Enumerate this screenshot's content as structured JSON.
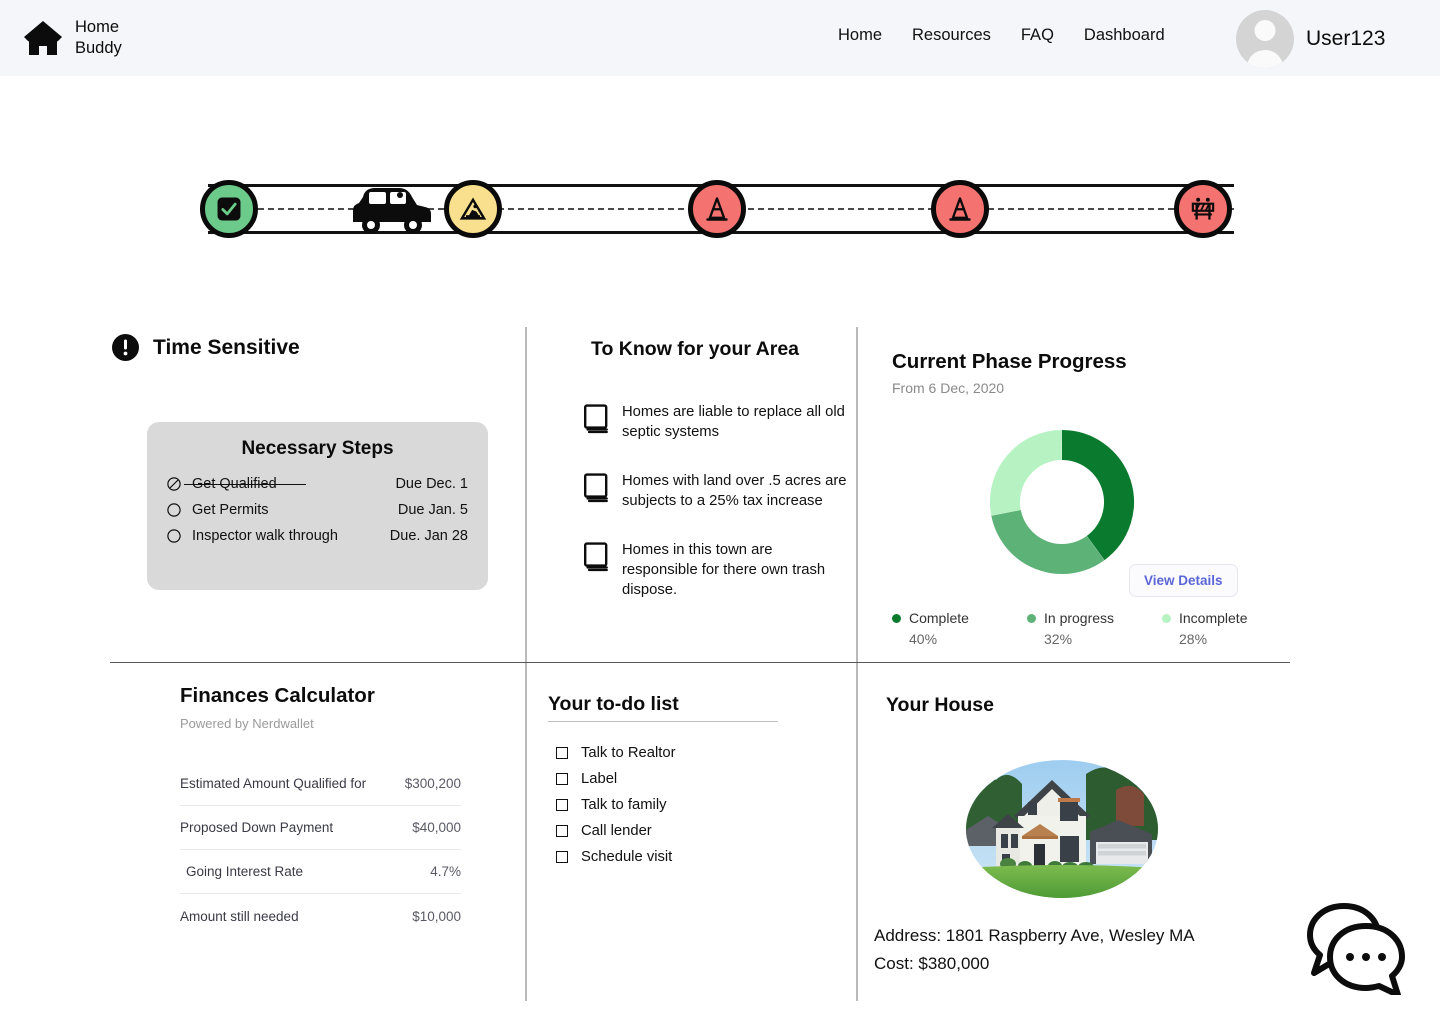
{
  "brand": {
    "line1": "Home",
    "line2": "Buddy",
    "icon": "house-icon"
  },
  "nav": {
    "items": [
      {
        "label": "Home"
      },
      {
        "label": "Resources"
      },
      {
        "label": "FAQ"
      },
      {
        "label": "Dashboard"
      }
    ],
    "user": {
      "name": "User123",
      "avatar_icon": "avatar-placeholder-icon"
    }
  },
  "timeline": {
    "stops": [
      {
        "icon": "checkbox-checked-icon",
        "state": "complete",
        "color": "#6ccb8b"
      },
      {
        "icon": "car-icon",
        "state": "current-vehicle",
        "color": "#0a0a0a"
      },
      {
        "icon": "construction-sign-icon",
        "state": "in-progress",
        "color": "#f8e08e"
      },
      {
        "icon": "traffic-cone-icon",
        "state": "upcoming",
        "color": "#f4726f"
      },
      {
        "icon": "traffic-cone-icon",
        "state": "upcoming",
        "color": "#f4726f"
      },
      {
        "icon": "road-barricade-icon",
        "state": "upcoming",
        "color": "#f4726f"
      }
    ]
  },
  "time_sensitive": {
    "title": "Time Sensitive",
    "icon": "exclamation-circle-icon",
    "card": {
      "title": "Necessary Steps",
      "steps": [
        {
          "label": "Get Qualified",
          "due": "Due Dec. 1",
          "done": true
        },
        {
          "label": "Get Permits",
          "due": "Due Jan. 5",
          "done": false
        },
        {
          "label": "Inspector walk through",
          "due": "Due. Jan 28",
          "done": false
        }
      ]
    }
  },
  "to_know": {
    "title": "To Know for your Area",
    "items": [
      {
        "icon": "book-icon",
        "text": "Homes are liable to replace all old septic systems"
      },
      {
        "icon": "book-icon",
        "text": "Homes with land over .5 acres are subjects to a 25% tax increase"
      },
      {
        "icon": "book-icon",
        "text": "Homes in this town are responsible for there own trash dispose."
      }
    ]
  },
  "phase_progress": {
    "title": "Current Phase Progress",
    "subtitle": "From 6 Dec, 2020",
    "view_details_label": "View Details",
    "chart_data": {
      "type": "pie",
      "title": "Current Phase Progress",
      "subtitle": "From 6 Dec, 2020",
      "categories": [
        "Complete",
        "In progress",
        "Incomplete"
      ],
      "values": [
        40,
        32,
        28
      ],
      "value_labels": [
        "40%",
        "32%",
        "28%"
      ],
      "colors": [
        "#0a7a2f",
        "#5cb277",
        "#b6f2c2"
      ],
      "track_color": "#dcdcf0",
      "legend_position": "bottom",
      "grid": false,
      "donut": true,
      "units": "percent"
    }
  },
  "finances": {
    "title": "Finances Calculator",
    "subtitle": "Powered by Nerdwallet",
    "rows": [
      {
        "label": "Estimated Amount Qualified for",
        "value": "$300,200"
      },
      {
        "label": "Proposed Down Payment",
        "value": "$40,000"
      },
      {
        "label": "Going Interest Rate",
        "value": "4.7%"
      },
      {
        "label": "Amount still needed",
        "value": "$10,000"
      }
    ]
  },
  "todo": {
    "title": "Your to-do list",
    "items": [
      {
        "label": "Talk to Realtor",
        "checked": false
      },
      {
        "label": "Label",
        "checked": false
      },
      {
        "label": "Talk to family",
        "checked": false
      },
      {
        "label": "Call lender",
        "checked": false
      },
      {
        "label": "Schedule visit",
        "checked": false
      }
    ]
  },
  "your_house": {
    "title": "Your House",
    "photo_alt": "house-photo",
    "address": "Address: 1801 Raspberry Ave, Wesley MA",
    "cost": "Cost: $380,000"
  },
  "chat": {
    "icon": "chat-bubbles-icon"
  },
  "colors": {
    "header_bg": "#f4f6fa",
    "accent_link": "#5b66d6",
    "complete": "#0a7a2f",
    "in_progress": "#5cb277",
    "incomplete": "#b6f2c2",
    "warn_yellow": "#f8e08e",
    "alert_red": "#f4726f",
    "go_green": "#6ccb8b"
  }
}
